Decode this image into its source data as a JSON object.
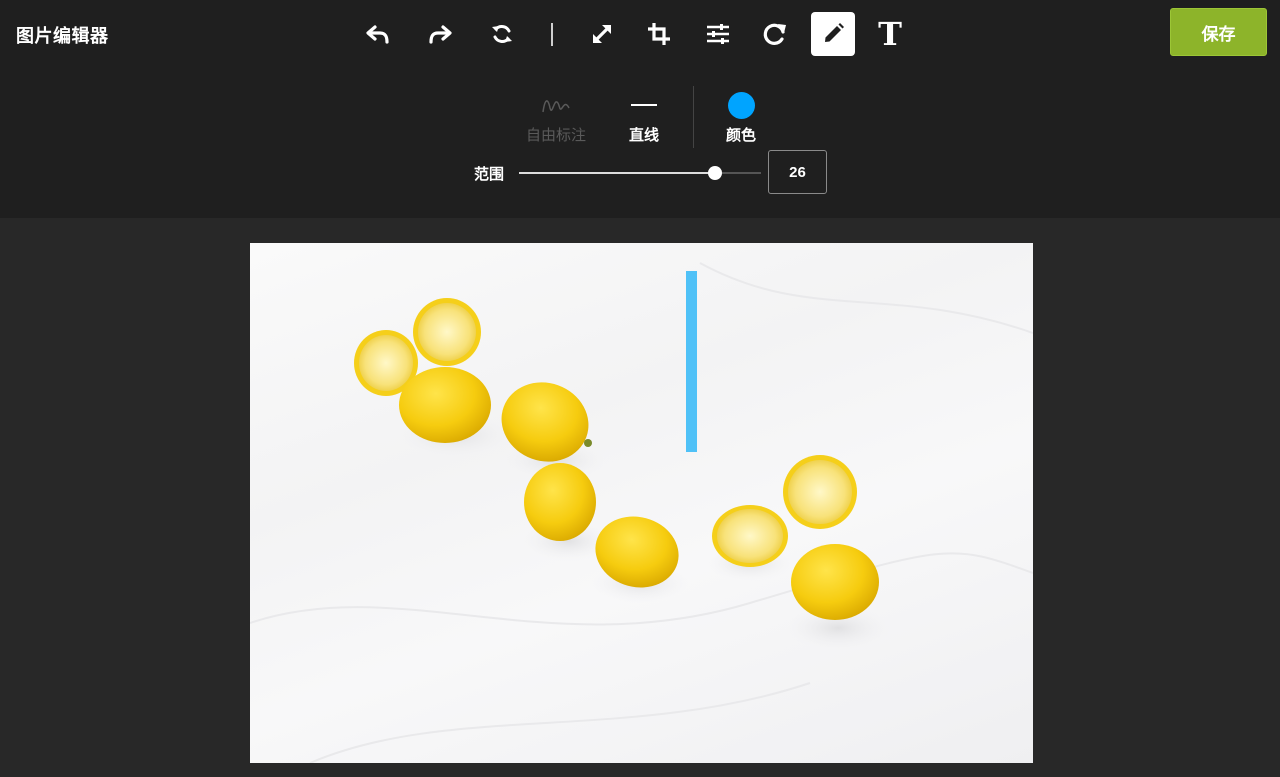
{
  "app": {
    "title": "图片编辑器"
  },
  "toolbar": {
    "tools": [
      {
        "name": "undo-icon"
      },
      {
        "name": "redo-icon"
      },
      {
        "name": "reset-icon"
      },
      {
        "name": "resize-icon"
      },
      {
        "name": "crop-icon"
      },
      {
        "name": "adjust-icon"
      },
      {
        "name": "rotate-icon"
      },
      {
        "name": "pencil-icon",
        "active": true
      },
      {
        "name": "text-icon"
      }
    ],
    "text_tool_glyph": "T",
    "save_label": "保存",
    "save_color": "#8db42a"
  },
  "draw_options": {
    "freehand_label": "自由标注",
    "freehand_disabled": true,
    "line_label": "直线",
    "color_label": "颜色",
    "current_color": "#00a4ff"
  },
  "range": {
    "label": "范围",
    "value": "26",
    "slider_fraction": 0.81
  },
  "canvas": {
    "image_subject": "lemons-on-white-cloth",
    "annotation_color": "#4fc1f7"
  }
}
